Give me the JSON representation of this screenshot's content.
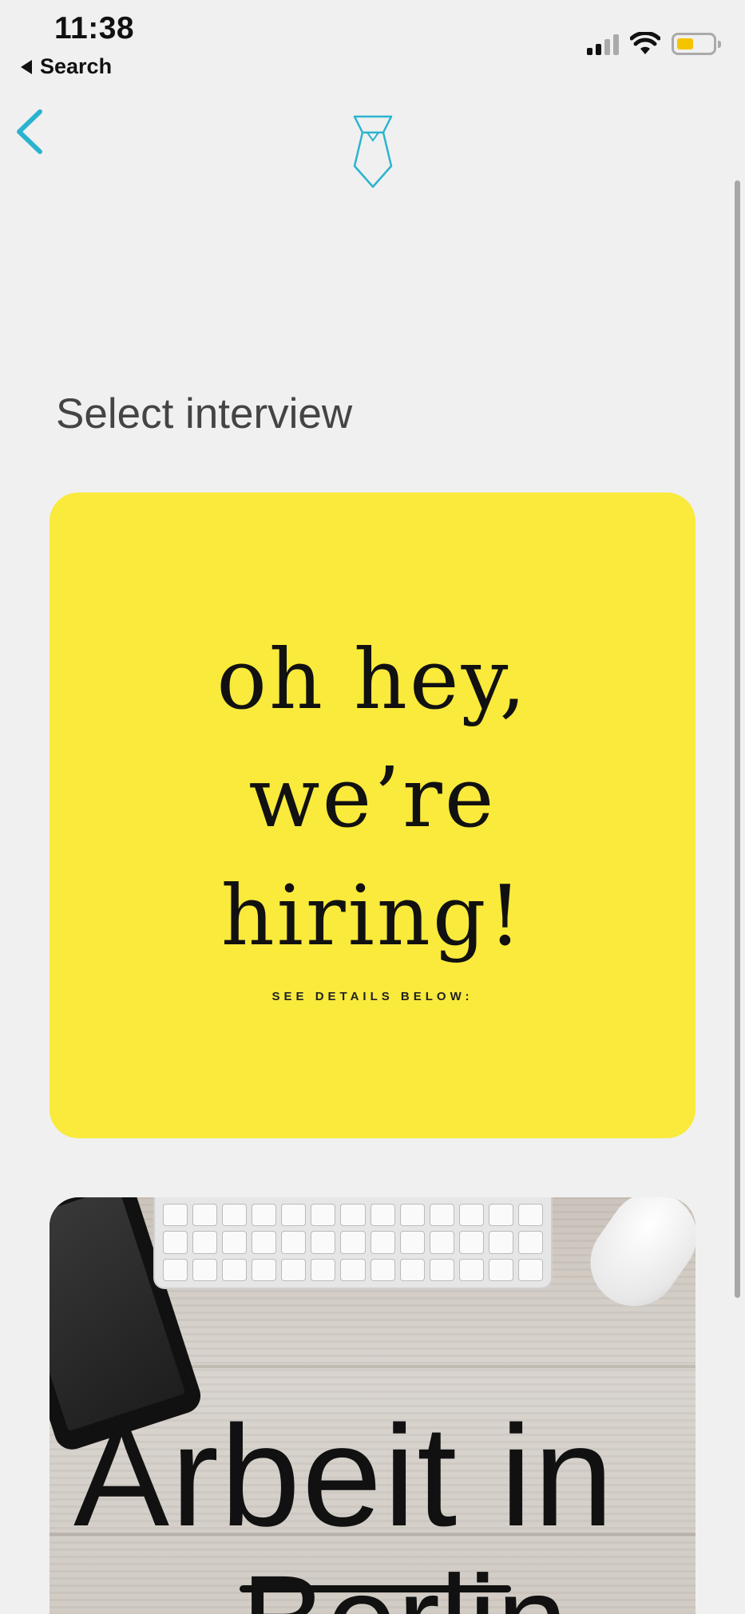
{
  "status_bar": {
    "time": "11:38",
    "back_label": "Search",
    "battery_color": "#f5c400"
  },
  "nav": {
    "back_icon": "chevron-left-icon",
    "logo_icon": "tie-icon",
    "accent_color": "#2ab3cf"
  },
  "page": {
    "title": "Select interview"
  },
  "cards": [
    {
      "image": "hiring-banner",
      "headline_lines": [
        "oh hey,",
        "we’re",
        "hiring!"
      ],
      "subtext": "SEE DETAILS BELOW:",
      "background": "#f9ea3c"
    },
    {
      "image": "desk-keyboard-photo",
      "headline_line1": "Arbeit in",
      "headline_line2": "Berlin"
    }
  ]
}
